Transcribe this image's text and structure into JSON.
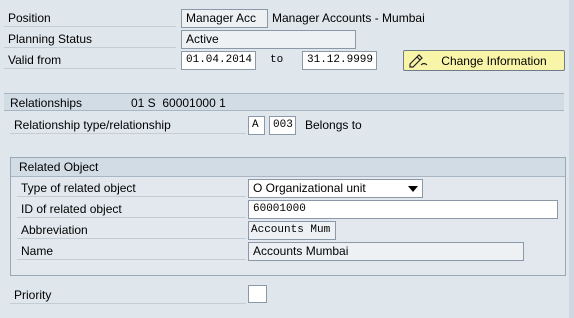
{
  "header": {
    "position_label": "Position",
    "position_short": "Manager Acc",
    "position_long": "Manager Accounts - Mumbai",
    "planning_status_label": "Planning Status",
    "planning_status_value": "Active",
    "valid_from_label": "Valid from",
    "valid_from_value": "01.04.2014",
    "to_label": "to",
    "valid_to_value": "31.12.9999",
    "change_button_label": "Change Information",
    "change_button_icon": "pen-edit-icon"
  },
  "relationships": {
    "section_label": "Relationships",
    "section_info": "01 S  60001000 1",
    "type_label": "Relationship type/relationship",
    "type_code": "A",
    "rel_code": "003",
    "rel_text": "Belongs to"
  },
  "related_object": {
    "group_title": "Related Object",
    "type_label": "Type of related object",
    "type_value": "O Organizational unit",
    "id_label": "ID of related object",
    "id_value": "60001000",
    "abbr_label": "Abbreviation",
    "abbr_value": "Accounts Mum",
    "name_label": "Name",
    "name_value": "Accounts Mumbai"
  },
  "priority": {
    "label": "Priority"
  },
  "colors": {
    "background": "#dfe6ec",
    "button_yellow": "#f8f5a8",
    "section_header": "#d2dce5"
  }
}
